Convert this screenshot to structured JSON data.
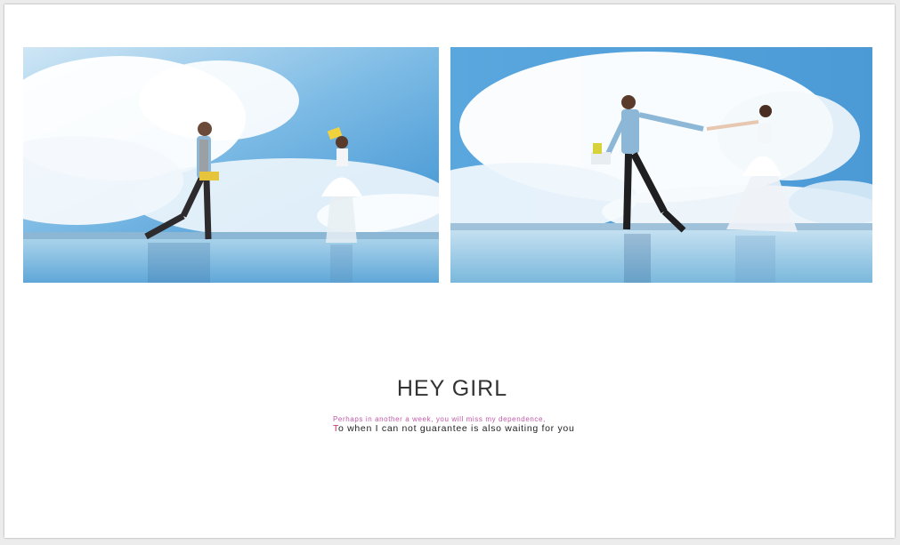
{
  "title": "HEY GIRL",
  "subtitle_small": "Perhaps in another a week, you will miss my dependence,",
  "subtitle_main_first": "T",
  "subtitle_main_rest": "o when I can not guarantee is also waiting for you",
  "colors": {
    "sky": "#4f9fd6",
    "water": "#7ab8dc",
    "accent_pink": "#c05aa6",
    "text_dark": "#333333"
  }
}
